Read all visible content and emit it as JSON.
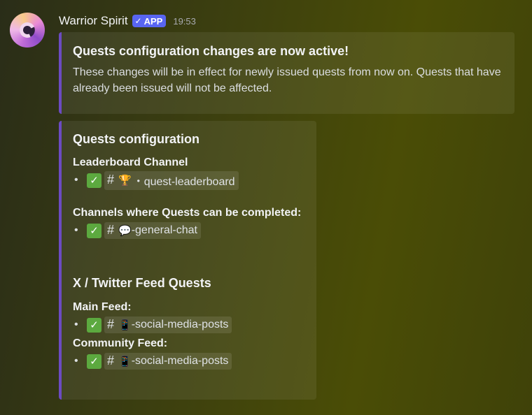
{
  "message": {
    "author": "Warrior Spirit",
    "badge": "APP",
    "badge_check": "✓",
    "time": "19:53"
  },
  "embed1": {
    "title": "Quests configuration changes are now active!",
    "description": "These changes will be in effect for newly issued quests from now on. Quests that have already been issued will not be affected."
  },
  "embed2": {
    "title": "Quests configuration",
    "leaderboard_label": "Leaderboard Channel",
    "leaderboard_channel": {
      "check": "✓",
      "hash": "#",
      "emoji": "🏆",
      "name": "・quest-leaderboard"
    },
    "completion_label": "Channels where Quests can be completed:",
    "completion_channel": {
      "check": "✓",
      "hash": "#",
      "emoji": "💬",
      "name": "-general-chat"
    },
    "x_section_title": "X / Twitter Feed Quests",
    "main_feed_label": "Main Feed:",
    "main_feed_channel": {
      "check": "✓",
      "hash": "#",
      "emoji": "📱",
      "name": "-social-media-posts"
    },
    "community_feed_label": "Community Feed:",
    "community_feed_channel": {
      "check": "✓",
      "hash": "#",
      "emoji": "📱",
      "name": "-social-media-posts"
    }
  },
  "colors": {
    "accent_bar": "#6c4bc2",
    "app_badge": "#5865f2",
    "check_green": "#5ca93f"
  },
  "icons": {
    "avatar": "bot-avatar-icon",
    "check": "checkmark-icon",
    "channel": "hashtag-icon"
  }
}
